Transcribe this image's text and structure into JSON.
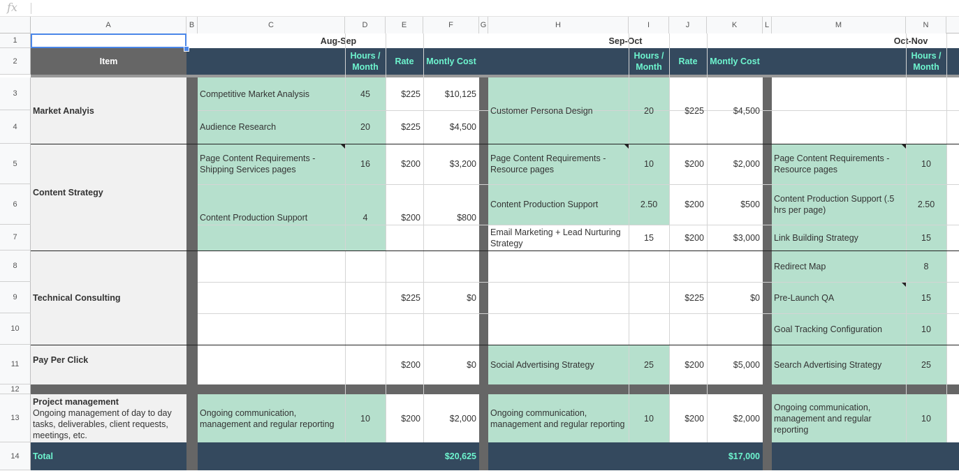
{
  "formula_bar": {
    "fx_icon": "fx",
    "value": ""
  },
  "columns": [
    "A",
    "B",
    "C",
    "D",
    "E",
    "F",
    "G",
    "H",
    "I",
    "J",
    "K",
    "L",
    "M",
    "N"
  ],
  "rows": [
    "1",
    "2",
    "3",
    "4",
    "5",
    "6",
    "7",
    "8",
    "9",
    "10",
    "11",
    "12",
    "13",
    "14"
  ],
  "period_headers": {
    "p1": "Aug-Sep",
    "p2": "Sep-Oct",
    "p3": "Oct-Nov"
  },
  "table_header": {
    "item": "Item",
    "hours": "Hours / Month",
    "rate": "Rate",
    "cost": "Montly Cost"
  },
  "categories": {
    "market": "Market Analyis",
    "content": "Content Strategy",
    "technical": "Technical Consulting",
    "ppc": "Pay Per Click",
    "pm_title": "Project management",
    "pm_desc": "Ongoing management of day to day tasks, deliverables, client requests, meetings, etc.",
    "total": "Total"
  },
  "aug_sep": {
    "r3": {
      "task": "Competitive Market Analysis",
      "hours": "45",
      "rate": "$225",
      "cost": "$10,125"
    },
    "r4": {
      "task": "Audience Research",
      "hours": "20",
      "rate": "$225",
      "cost": "$4,500"
    },
    "r5": {
      "task": "Page Content Requirements - Shipping Services pages",
      "hours": "16",
      "rate": "$200",
      "cost": "$3,200"
    },
    "r6": {
      "task": "Content Production Support",
      "hours": "4",
      "rate": "$200",
      "cost": "$800"
    },
    "tech": {
      "rate": "$225",
      "cost": "$0"
    },
    "ppc": {
      "rate": "$200",
      "cost": "$0"
    },
    "pm": {
      "task": "Ongoing communication, management and regular reporting",
      "hours": "10",
      "rate": "$200",
      "cost": "$2,000"
    },
    "total": "$20,625"
  },
  "sep_oct": {
    "market": {
      "task": "Customer Persona Design",
      "hours": "20",
      "rate": "$225",
      "cost": "$4,500"
    },
    "r5": {
      "task": "Page Content Requirements - Resource pages",
      "hours": "10",
      "rate": "$200",
      "cost": "$2,000"
    },
    "r6": {
      "task": "Content Production Support",
      "hours": "2.50",
      "rate": "$200",
      "cost": "$500"
    },
    "r7": {
      "task": "Email Marketing + Lead Nurturing Strategy",
      "hours": "15",
      "rate": "$200",
      "cost": "$3,000"
    },
    "tech": {
      "rate": "$225",
      "cost": "$0"
    },
    "ppc": {
      "task": "Social Advertising Strategy",
      "hours": "25",
      "rate": "$200",
      "cost": "$5,000"
    },
    "pm": {
      "task": "Ongoing communication, management and regular reporting",
      "hours": "10",
      "rate": "$200",
      "cost": "$2,000"
    },
    "total": "$17,000"
  },
  "oct_nov": {
    "r5": {
      "task": "Page Content Requirements - Resource pages",
      "hours": "10"
    },
    "r6": {
      "task": "Content Production Support (.5 hrs per page)",
      "hours": "2.50"
    },
    "r7": {
      "task": "Link Building Strategy",
      "hours": "15"
    },
    "r8": {
      "task": "Redirect Map",
      "hours": "8"
    },
    "r9": {
      "task": "Pre-Launch QA",
      "hours": "15"
    },
    "r10": {
      "task": "Goal Tracking Configuration",
      "hours": "10"
    },
    "ppc": {
      "task": "Search Advertising Strategy",
      "hours": "25"
    },
    "pm": {
      "task": "Ongoing communication, management and regular reporting",
      "hours": "10"
    }
  },
  "colors": {
    "navy": "#34495e",
    "mint_text": "#6ef5cf",
    "green_fill": "#b6e0cd",
    "gray_fill": "#f1f1f1",
    "separator": "#666666",
    "selection": "#4a86e8"
  }
}
